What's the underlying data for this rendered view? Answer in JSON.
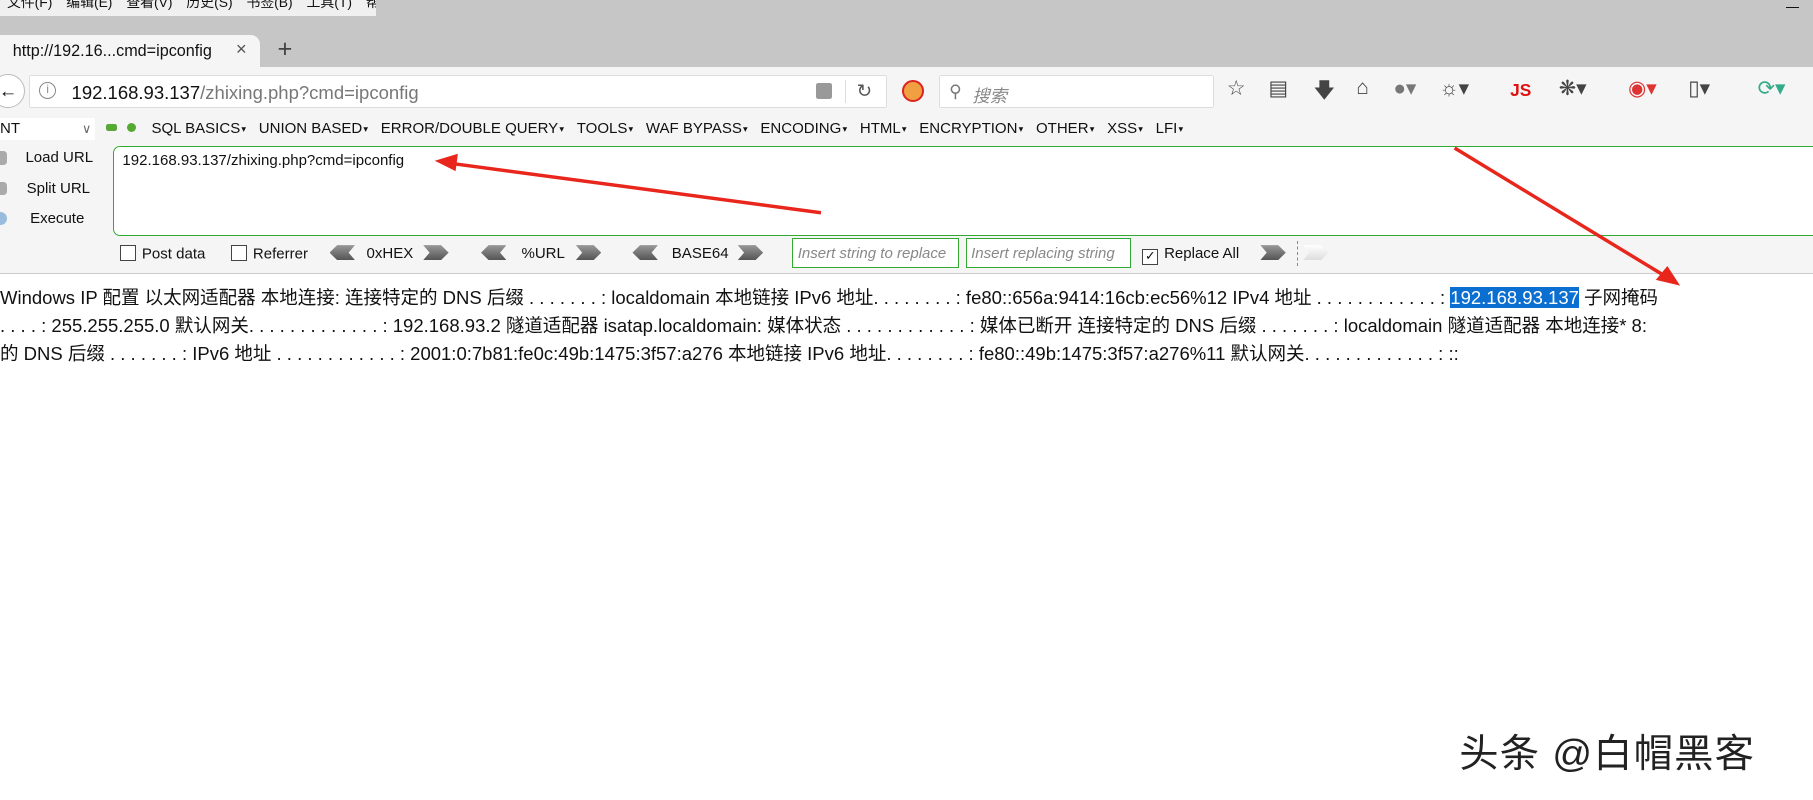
{
  "menubar": {
    "items": [
      "文件(F)",
      "编辑(E)",
      "查看(V)",
      "历史(S)",
      "书签(B)",
      "工具(T)",
      "帮助(H)"
    ]
  },
  "tab": {
    "title": "http://192.16...cmd=ipconfig",
    "close": "×",
    "new_tab": "+"
  },
  "address_bar": {
    "host": "192.168.93.137",
    "path": "/zhixing.php?cmd=ipconfig"
  },
  "search": {
    "placeholder": "搜索"
  },
  "toolbar_icons": [
    "bookmark-star-icon",
    "reading-list-icon",
    "download-icon",
    "home-icon",
    "globe-icon",
    "cookie-icon",
    "js-icon",
    "bug-icon",
    "hackbar-icon",
    "devices-icon",
    "sync-icon"
  ],
  "toolbar_js_label": "JS",
  "hackbar": {
    "select_value": "NT",
    "menu": [
      "SQL BASICS",
      "UNION BASED",
      "ERROR/DOUBLE QUERY",
      "TOOLS",
      "WAF BYPASS",
      "ENCODING",
      "HTML",
      "ENCRYPTION",
      "OTHER",
      "XSS",
      "LFI"
    ],
    "load_url": "Load URL",
    "split_url": "Split URL",
    "execute": "Execute",
    "url_value": "192.168.93.137/zhixing.php?cmd=ipconfig",
    "post_data": "Post data",
    "referrer": "Referrer",
    "hex": "0xHEX",
    "url_enc": "%URL",
    "base64": "BASE64",
    "replace_placeholder": "Insert string to replace",
    "replacing_placeholder": "Insert replacing string",
    "replace_all": "Replace All",
    "replace_all_checked": true
  },
  "content": {
    "line1_before": "Windows IP 配置 以太网适配器 本地连接: 连接特定的 DNS 后缀 . . . . . . . : localdomain 本地链接 IPv6 地址. . . . . . . . : fe80::656a:9414:16cb:ec56%12 IPv4 地址 . . . . . . . . . . . . : ",
    "highlight": "192.168.93.137",
    "line1_after": " 子网掩码",
    "line2": ". . . . : 255.255.255.0 默认网关. . . . . . . . . . . . . : 192.168.93.2 隧道适配器 isatap.localdomain: 媒体状态 . . . . . . . . . . . . : 媒体已断开 连接特定的 DNS 后缀 . . . . . . . : localdomain 隧道适配器 本地连接* 8:",
    "line3": "的 DNS 后缀 . . . . . . . : IPv6 地址 . . . . . . . . . . . . : 2001:0:7b81:fe0c:49b:1475:3f57:a276 本地链接 IPv6 地址. . . . . . . . : fe80::49b:1475:3f57:a276%11 默认网关. . . . . . . . . . . . . : ::"
  },
  "watermark": "头条 @白帽黑客",
  "colors": {
    "highlight": "#0a6fd0",
    "annotation_arrow": "#e8261c",
    "hackbar_border": "#33aa33"
  }
}
